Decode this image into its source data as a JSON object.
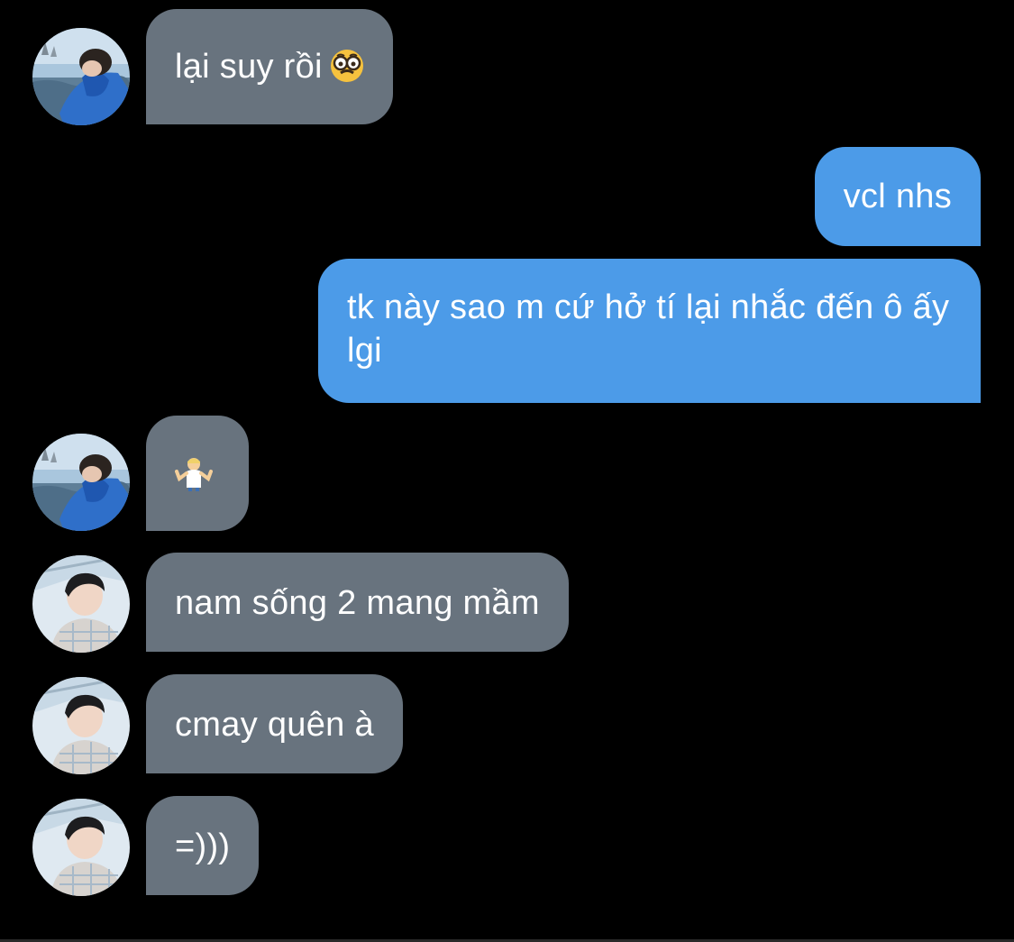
{
  "conversation": {
    "messages": [
      {
        "sender": "contact_a",
        "direction": "incoming",
        "text": "lại suy rồi",
        "emoji": "nerd-face-glasses-icon"
      },
      {
        "sender": "me",
        "direction": "outgoing",
        "text": "vcl nhs"
      },
      {
        "sender": "me",
        "direction": "outgoing",
        "text": "tk này sao m cứ hở tí lại nhắc đến ô ấy lgi"
      },
      {
        "sender": "contact_a",
        "direction": "incoming",
        "text": "",
        "emoji": "person-shrugging-icon"
      },
      {
        "sender": "contact_b",
        "direction": "incoming",
        "text": "nam sống 2 mang mầm"
      },
      {
        "sender": "contact_b",
        "direction": "incoming",
        "text": "cmay quên à"
      },
      {
        "sender": "contact_b",
        "direction": "incoming",
        "text": "=)))"
      }
    ]
  },
  "colors": {
    "background": "#000000",
    "incoming_bubble": "#68737e",
    "outgoing_bubble": "#4c9be8",
    "text": "#ffffff"
  }
}
